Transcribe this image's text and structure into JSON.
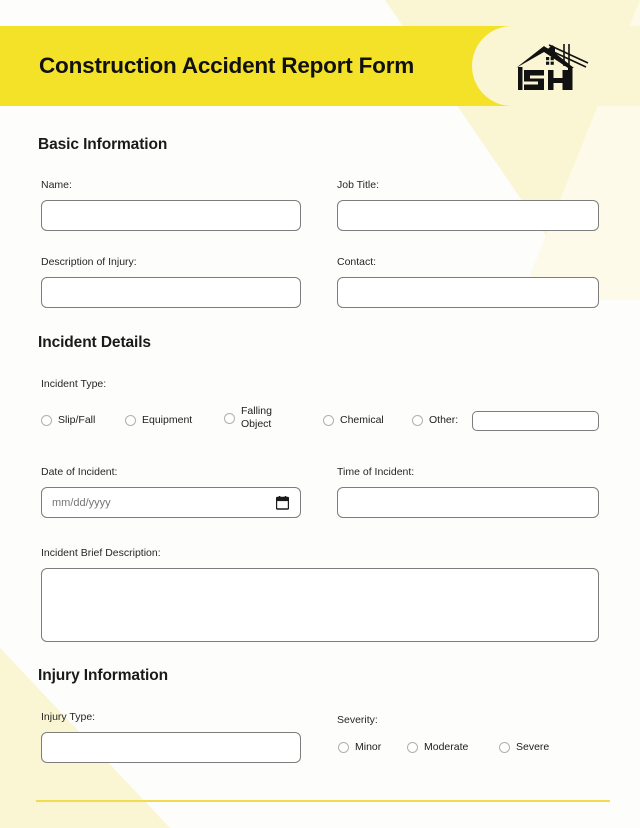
{
  "header": {
    "title": "Construction Accident Report Form",
    "logo_alt": "SH house logo",
    "bar_color": "#f4e229",
    "panel_color": "#faf5d2"
  },
  "sections": {
    "basic": {
      "heading": "Basic Information",
      "name_label": "Name:",
      "name_value": "",
      "job_title_label": "Job Title:",
      "job_title_value": "",
      "description_injury_label": "Description of Injury:",
      "description_injury_value": "",
      "contact_label": "Contact:",
      "contact_value": ""
    },
    "incident": {
      "heading": "Incident Details",
      "type_label": "Incident Type:",
      "type_options": [
        "Slip/Fall",
        "Equipment",
        "Falling Object",
        "Chemical",
        "Other:"
      ],
      "other_value": "",
      "date_label": "Date of Incident:",
      "date_placeholder": "mm/dd/yyyy",
      "date_value": "",
      "time_label": "Time of Incident:",
      "time_value": "",
      "brief_label": "Incident Brief Description:",
      "brief_value": ""
    },
    "injury": {
      "heading": "Injury Information",
      "injury_type_label": "Injury Type:",
      "injury_type_value": "",
      "severity_label": "Severity:",
      "severity_options": [
        "Minor",
        "Moderate",
        "Severe"
      ]
    }
  },
  "decoration": {
    "accent_pale": "#faf5d2",
    "accent_bright": "#f4e229",
    "footer_rule_color": "#f0dc4e"
  }
}
